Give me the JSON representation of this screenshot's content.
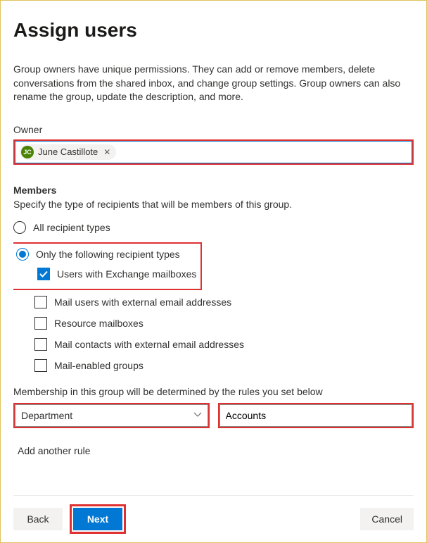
{
  "title": "Assign users",
  "description": "Group owners have unique permissions. They can add or remove members, delete conversations from the shared inbox, and change group settings. Group owners can also rename the group, update the description, and more.",
  "owner": {
    "label": "Owner",
    "chip": {
      "initials": "JC",
      "name": "June Castillote"
    }
  },
  "members": {
    "heading": "Members",
    "description": "Specify the type of recipients that will be members of this group.",
    "options": {
      "all": {
        "label": "All recipient types",
        "selected": false
      },
      "only": {
        "label": "Only the following recipient types",
        "selected": true
      }
    },
    "subtypes": [
      {
        "key": "exchange",
        "label": "Users with Exchange mailboxes",
        "checked": true
      },
      {
        "key": "mailusers",
        "label": "Mail users with external email addresses",
        "checked": false
      },
      {
        "key": "resource",
        "label": "Resource mailboxes",
        "checked": false
      },
      {
        "key": "contacts",
        "label": "Mail contacts with external email addresses",
        "checked": false
      },
      {
        "key": "mailgroups",
        "label": "Mail-enabled groups",
        "checked": false
      }
    ]
  },
  "rule": {
    "intro": "Membership in this group will be determined by the rules you set below",
    "attribute": "Department",
    "value": "Accounts",
    "add_another": "Add another rule"
  },
  "buttons": {
    "back": "Back",
    "next": "Next",
    "cancel": "Cancel"
  }
}
